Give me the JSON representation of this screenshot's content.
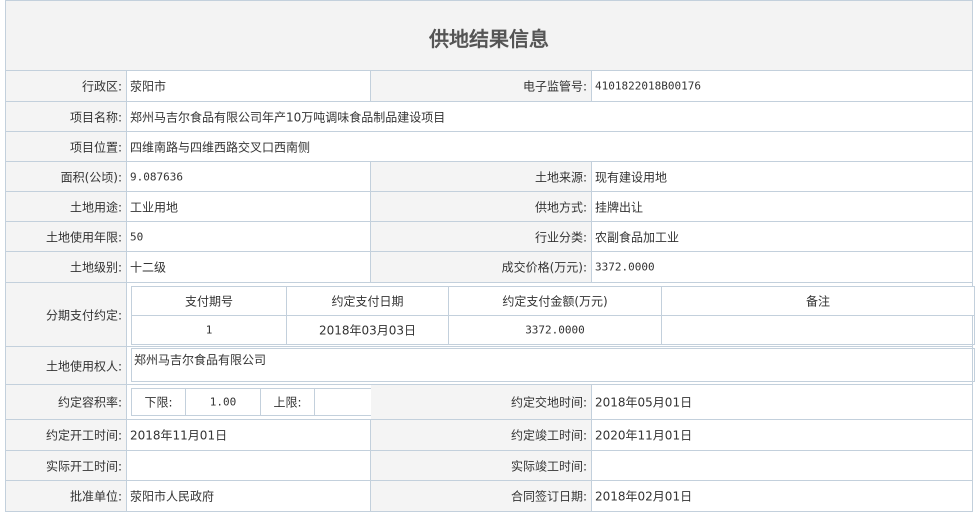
{
  "page_title": "供地结果信息",
  "rows": {
    "region": {
      "label": "行政区:",
      "value": "荥阳市"
    },
    "supervision_no": {
      "label": "电子监管号:",
      "value": "4101822018B00176"
    },
    "project_name": {
      "label": "项目名称:",
      "value": "郑州马吉尔食品有限公司年产10万吨调味食品制品建设项目"
    },
    "project_location": {
      "label": "项目位置:",
      "value": "四维南路与四维西路交叉口西南侧"
    },
    "area": {
      "label": "面积(公顷):",
      "value": "9.087636"
    },
    "land_source": {
      "label": "土地来源:",
      "value": "现有建设用地"
    },
    "land_use": {
      "label": "土地用途:",
      "value": "工业用地"
    },
    "supply_method": {
      "label": "供地方式:",
      "value": "挂牌出让"
    },
    "use_years": {
      "label": "土地使用年限:",
      "value": "50"
    },
    "industry": {
      "label": "行业分类:",
      "value": "农副食品加工业"
    },
    "land_grade": {
      "label": "土地级别:",
      "value": "十二级"
    },
    "price": {
      "label": "成交价格(万元):",
      "value": "3372.0000"
    },
    "installment": {
      "label": "分期支付约定:",
      "headers": [
        "支付期号",
        "约定支付日期",
        "约定支付金额(万元)",
        "备注"
      ],
      "rows": [
        [
          "1",
          "2018年03月03日",
          "3372.0000",
          ""
        ]
      ]
    },
    "land_user": {
      "label": "土地使用权人:",
      "value": "郑州马吉尔食品有限公司"
    },
    "far": {
      "label": "约定容积率:",
      "lower_label": "下限:",
      "lower_value": "1.00",
      "upper_label": "上限:",
      "upper_value": ""
    },
    "delivery_date": {
      "label": "约定交地时间:",
      "value": "2018年05月01日"
    },
    "start_date": {
      "label": "约定开工时间:",
      "value": "2018年11月01日"
    },
    "completion_date": {
      "label": "约定竣工时间:",
      "value": "2020年11月01日"
    },
    "actual_start": {
      "label": "实际开工时间:",
      "value": ""
    },
    "actual_completion": {
      "label": "实际竣工时间:",
      "value": ""
    },
    "approval_unit": {
      "label": "批准单位:",
      "value": "荥阳市人民政府"
    },
    "contract_date": {
      "label": "合同签订日期:",
      "value": "2018年02月01日"
    }
  }
}
